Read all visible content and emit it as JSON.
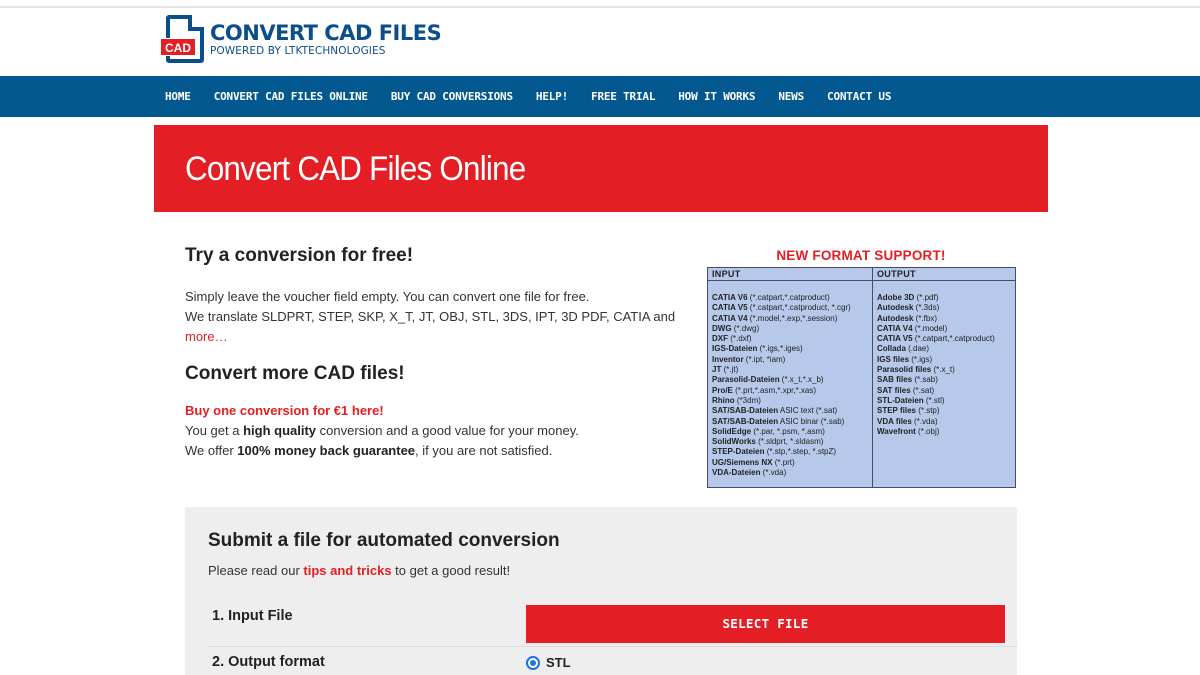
{
  "header": {
    "logo_badge": "CAD",
    "logo_title": "CONVERT CAD FILES",
    "logo_subtitle": "POWERED BY LTKTECHNOLOGIES"
  },
  "nav": {
    "items": [
      {
        "label": "HOME"
      },
      {
        "label": "CONVERT CAD FILES ONLINE"
      },
      {
        "label": "BUY CAD CONVERSIONS"
      },
      {
        "label": "HELP!"
      },
      {
        "label": "FREE TRIAL"
      },
      {
        "label": "HOW IT WORKS"
      },
      {
        "label": "NEWS"
      },
      {
        "label": "CONTACT US"
      }
    ]
  },
  "banner": {
    "title": "Convert CAD Files Online"
  },
  "intro": {
    "heading_free": "Try a conversion for free!",
    "free_line1": "Simply leave the voucher field empty. You can convert one file for free.",
    "free_line2": "We translate SLDPRT, STEP, SKP, X_T, JT, OBJ, STL, 3DS, IPT, 3D PDF, CATIA and ",
    "free_more_link": "more…",
    "heading_more": "Convert more CAD files!",
    "buy_link": "Buy one conversion for €1 here!",
    "quality_pre": "You get a ",
    "quality_bold": "high quality",
    "quality_post": " conversion and a good value for your money.",
    "guarantee_pre": "We offer ",
    "guarantee_bold": "100% money back guarantee",
    "guarantee_post": ", if you are not satisfied."
  },
  "format_support": {
    "title": "NEW FORMAT SUPPORT!",
    "input_header": "INPUT",
    "output_header": "OUTPUT",
    "inputs": [
      {
        "name": "CATIA V6",
        "ext": " (*.catpart,*.catproduct)"
      },
      {
        "name": "CATIA V5",
        "ext": " (*.catpart,*.catproduct, *.cgr)"
      },
      {
        "name": "CATIA V4",
        "ext": " (*.model,*.exp,*.session)"
      },
      {
        "name": "DWG",
        "ext": " (*.dwg)"
      },
      {
        "name": "DXF",
        "ext": " (*.dxf)"
      },
      {
        "name": "IGS-Dateien",
        "ext": " (*.igs,*.iges)"
      },
      {
        "name": "Inventor",
        "ext": " (*.ipt, *iam)"
      },
      {
        "name": "JT",
        "ext": " (*.jt)"
      },
      {
        "name": "Parasolid-Dateien",
        "ext": " (*.x_t,*.x_b)"
      },
      {
        "name": "Pro/E",
        "ext": " (*.prt,*.asm,*.xpr,*.xas)"
      },
      {
        "name": "Rhino",
        "ext": " (*3dm)"
      },
      {
        "name": "SAT/SAB-Dateien",
        "ext": " ASIC text (*.sat)"
      },
      {
        "name": "SAT/SAB-Dateien",
        "ext": " ASIC binar (*.sab)"
      },
      {
        "name": "SolidEdge",
        "ext": " (*.par, *.psm, *.asm)"
      },
      {
        "name": "SolidWorks",
        "ext": " (*.sldprt, *.sldasm)"
      },
      {
        "name": "STEP-Dateien",
        "ext": " (*.stp,*.step, *.stpZ)"
      },
      {
        "name": "UG/Siemens NX",
        "ext": " (*.prt)"
      },
      {
        "name": "VDA-Dateien",
        "ext": " (*.vda)"
      }
    ],
    "outputs": [
      {
        "name": "Adobe 3D",
        "ext": " (*.pdf)"
      },
      {
        "name": "Autodesk",
        "ext": " (*.3ds)"
      },
      {
        "name": "Autodesk",
        "ext": " (*.fbx)"
      },
      {
        "name": "CATIA V4",
        "ext": " (*.model)"
      },
      {
        "name": "CATIA V5",
        "ext": " (*.catpart,*.catproduct)"
      },
      {
        "name": "Collada",
        "ext": " (.dae)"
      },
      {
        "name": "IGS files",
        "ext": " (*.igs)"
      },
      {
        "name": "Parasolid files",
        "ext": " (*.x_t)"
      },
      {
        "name": "SAB files",
        "ext": " (*.sab)"
      },
      {
        "name": "SAT files",
        "ext": " (*.sat)"
      },
      {
        "name": "STL-Dateien",
        "ext": " (*.stl)"
      },
      {
        "name": "STEP files",
        "ext": " (*.stp)"
      },
      {
        "name": "VDA files",
        "ext": " (*.vda)"
      },
      {
        "name": "Wavefront",
        "ext": " (*.obj)"
      }
    ]
  },
  "submit": {
    "title": "Submit a file for automated conversion",
    "hint_pre": "Please read our ",
    "hint_link": "tips and tricks",
    "hint_post": " to get a good result!",
    "step1_label": "1.  Input File",
    "select_button": "SELECT FILE",
    "step2_label": "2.  Output format",
    "output_option": "STL"
  },
  "colors": {
    "brand_blue": "#03588f",
    "accent_red": "#e31e24",
    "table_bg": "#b6c9ea"
  }
}
